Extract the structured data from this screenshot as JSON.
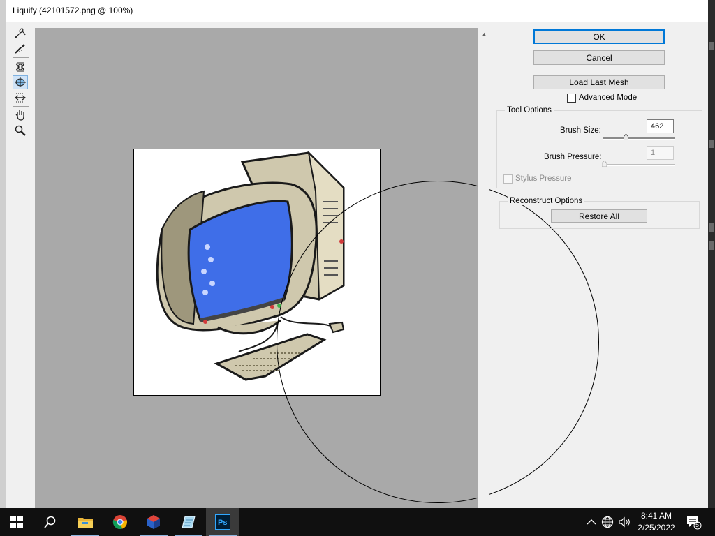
{
  "window": {
    "title": "Liquify (42101572.png @ 100%)"
  },
  "tools": [
    {
      "name": "forward-warp-tool-icon"
    },
    {
      "name": "reconstruct-tool-icon"
    },
    {
      "name": "pucker-tool-icon"
    },
    {
      "name": "bloat-tool-icon"
    },
    {
      "name": "push-left-tool-icon"
    },
    {
      "name": "hand-tool-icon"
    },
    {
      "name": "zoom-tool-icon"
    }
  ],
  "buttons": {
    "ok": "OK",
    "cancel": "Cancel",
    "load_last_mesh": "Load Last Mesh",
    "restore_all": "Restore All"
  },
  "advanced_mode": {
    "label": "Advanced Mode",
    "checked": false
  },
  "tool_options": {
    "title": "Tool Options",
    "brush_size": {
      "label": "Brush Size:",
      "value": "462"
    },
    "brush_pressure": {
      "label": "Brush Pressure:",
      "value": "1",
      "disabled": true
    },
    "stylus_pressure": {
      "label": "Stylus Pressure",
      "checked": false,
      "disabled": true
    }
  },
  "reconstruct_options": {
    "title": "Reconstruct Options"
  },
  "taskbar": {
    "apps": [
      "windows-start",
      "search",
      "file-explorer",
      "chrome",
      "3d-app",
      "notepad-app",
      "photoshop"
    ],
    "time": "8:41 AM",
    "date": "2/25/2022",
    "notification_count": "5"
  },
  "colors": {
    "accent": "#0078d7",
    "canvas_bg": "#a9a9a9",
    "screen_blue": "#3f6ee8"
  }
}
